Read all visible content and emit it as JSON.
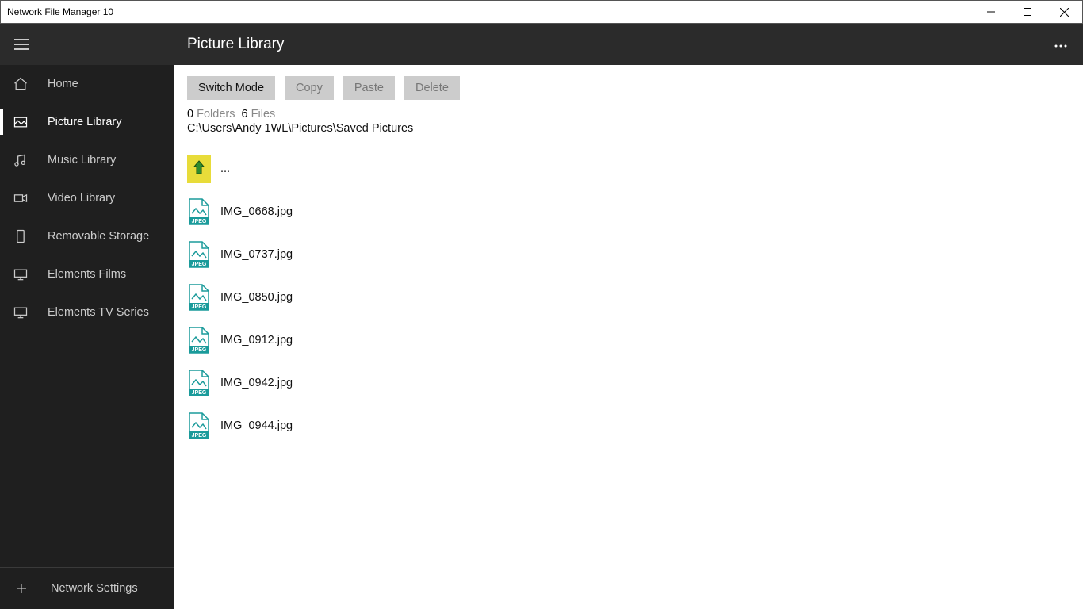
{
  "window": {
    "title": "Network File Manager 10"
  },
  "sidebar": {
    "items": [
      {
        "label": "Home"
      },
      {
        "label": "Picture Library"
      },
      {
        "label": "Music Library"
      },
      {
        "label": "Video Library"
      },
      {
        "label": "Removable Storage"
      },
      {
        "label": "Elements Films"
      },
      {
        "label": "Elements TV Series"
      }
    ],
    "footer": {
      "label": "Network Settings"
    }
  },
  "header": {
    "title": "Picture Library"
  },
  "toolbar": {
    "switch_mode": "Switch Mode",
    "copy": "Copy",
    "paste": "Paste",
    "delete": "Delete"
  },
  "counts": {
    "folders_count": "0",
    "folders_label": "Folders",
    "files_count": "6",
    "files_label": "Files"
  },
  "path": "C:\\Users\\Andy 1WL\\Pictures\\Saved Pictures",
  "up_label": "...",
  "files": [
    {
      "name": "IMG_0668.jpg"
    },
    {
      "name": "IMG_0737.jpg"
    },
    {
      "name": "IMG_0850.jpg"
    },
    {
      "name": "IMG_0912.jpg"
    },
    {
      "name": "IMG_0942.jpg"
    },
    {
      "name": "IMG_0944.jpg"
    }
  ]
}
